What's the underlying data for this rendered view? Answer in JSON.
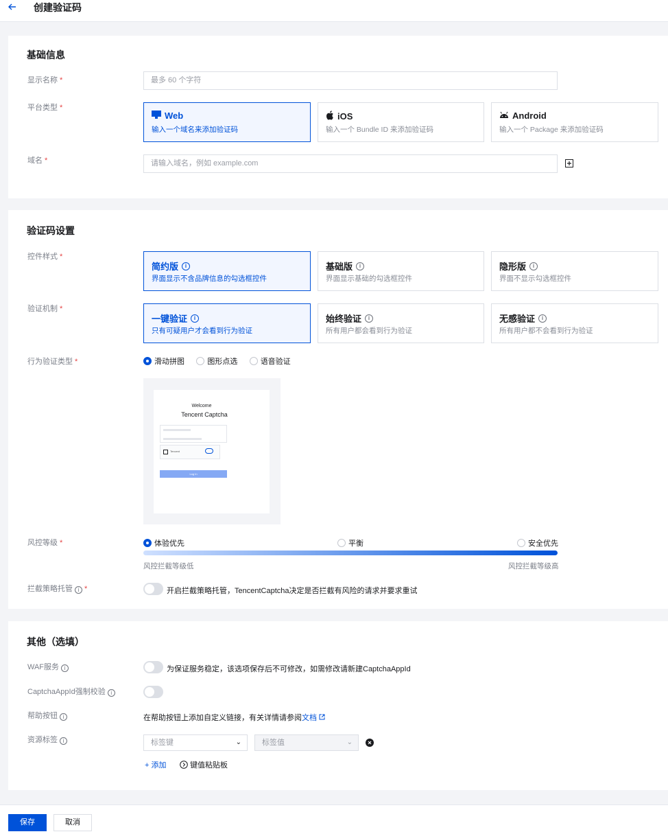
{
  "header": {
    "back_icon": "arrow-left-icon",
    "title": "创建验证码"
  },
  "basic": {
    "title": "基础信息",
    "display_name": {
      "label": "显示名称",
      "required": "*",
      "placeholder": "最多 60 个字符"
    },
    "platform": {
      "label": "平台类型",
      "required": "*",
      "options": [
        {
          "title": "Web",
          "desc": "输入一个域名来添加验证码",
          "icon": "monitor-icon",
          "selected": true
        },
        {
          "title": "iOS",
          "desc": "输入一个 Bundle ID 来添加验证码",
          "icon": "apple-icon",
          "selected": false
        },
        {
          "title": "Android",
          "desc": "输入一个 Package 来添加验证码",
          "icon": "android-icon",
          "selected": false
        }
      ]
    },
    "domain": {
      "label": "域名",
      "required": "*",
      "placeholder": "请输入域名，例如 example.com",
      "add_icon": "plus-square-icon"
    }
  },
  "captcha": {
    "title": "验证码设置",
    "style": {
      "label": "控件样式",
      "required": "*",
      "options": [
        {
          "title": "简约版",
          "desc": "界面显示不含品牌信息的勾选框控件",
          "selected": true
        },
        {
          "title": "基础版",
          "desc": "界面显示基础的勾选框控件",
          "selected": false
        },
        {
          "title": "隐形版",
          "desc": "界面不显示勾选框控件",
          "selected": false
        }
      ]
    },
    "mechanism": {
      "label": "验证机制",
      "required": "*",
      "options": [
        {
          "title": "一键验证",
          "desc": "只有可疑用户才会看到行为验证",
          "selected": true
        },
        {
          "title": "始终验证",
          "desc": "所有用户都会看到行为验证",
          "selected": false
        },
        {
          "title": "无感验证",
          "desc": "所有用户都不会看到行为验证",
          "selected": false
        }
      ]
    },
    "behavior": {
      "label": "行为验证类型",
      "required": "*",
      "options": [
        "滑动拼图",
        "图形点选",
        "语音验证"
      ],
      "selected": "滑动拼图"
    },
    "preview": {
      "welcome": "Welcome",
      "product": "Tencent Captcha",
      "captcha_text": "Tencent",
      "login": "Log In"
    },
    "risk": {
      "label": "风控等级",
      "required": "*",
      "options": [
        "体验优先",
        "平衡",
        "安全优先"
      ],
      "selected": "体验优先",
      "low": "风控拦截等级低",
      "high": "风控拦截等级高",
      "bar_start": "#cfe0ff",
      "bar_end": "#0052d9"
    },
    "intercept": {
      "label": "拦截策略托管",
      "required": "*",
      "toggle_on": false,
      "desc": "开启拦截策略托管，TencentCaptcha决定是否拦截有风险的请求并要求重试"
    }
  },
  "other": {
    "title": "其他（选填）",
    "waf": {
      "label": "WAF服务",
      "toggle_on": false,
      "desc": "为保证服务稳定，该选项保存后不可修改，如需修改请新建CaptchaAppId"
    },
    "appid_check": {
      "label": "CaptchaAppId强制校验",
      "toggle_on": false
    },
    "help": {
      "label": "帮助按钮",
      "desc": "在帮助按钮上添加自定义链接，有关详情请参阅",
      "link": "文档"
    },
    "tags": {
      "label": "资源标签",
      "key_placeholder": "标签键",
      "value_placeholder": "标签值",
      "add": "添加",
      "paste": "键值粘贴板"
    }
  },
  "footer": {
    "save": "保存",
    "cancel": "取消"
  },
  "colors": {
    "primary": "#0052d9",
    "required": "#e54545"
  }
}
